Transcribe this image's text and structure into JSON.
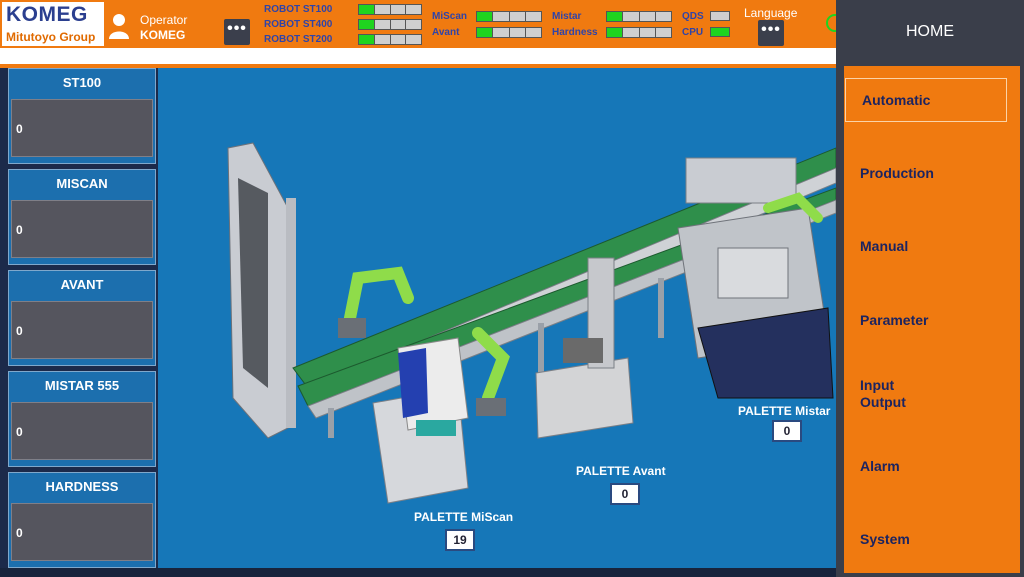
{
  "header": {
    "brand": "KOMEG",
    "group": "Mitutoyo Group",
    "operator_label": "Operator",
    "operator_name": "KOMEG",
    "more_glyph": "•••",
    "robots": [
      {
        "label": "ROBOT ST100",
        "segments": [
          true,
          false,
          false,
          false
        ]
      },
      {
        "label": "ROBOT ST400",
        "segments": [
          true,
          false,
          false,
          false
        ]
      },
      {
        "label": "ROBOT ST200",
        "segments": [
          true,
          false,
          false,
          false
        ]
      }
    ],
    "stations_status": [
      {
        "label": "MiScan",
        "segments": [
          true,
          false,
          false,
          false
        ]
      },
      {
        "label": "Avant",
        "segments": [
          true,
          false,
          false,
          false
        ]
      },
      {
        "label": "Mistar",
        "segments": [
          true,
          false,
          false,
          false
        ]
      },
      {
        "label": "Hardness",
        "segments": [
          true,
          false,
          false,
          false
        ]
      }
    ],
    "qds_label": "QDS",
    "cpu_label": "CPU",
    "language_label": "Language",
    "colors": {
      "header": "#f07a10",
      "led_on": "#1fd41f",
      "led_off": "#cfcfcf"
    }
  },
  "stations": [
    {
      "title": "ST100",
      "value": "0"
    },
    {
      "title": "MISCAN",
      "value": "0"
    },
    {
      "title": "AVANT",
      "value": "0"
    },
    {
      "title": "MISTAR 555",
      "value": "0"
    },
    {
      "title": "HARDNESS",
      "value": "0"
    }
  ],
  "scene": {
    "palettes": [
      {
        "label": "PALETTE MiScan",
        "value": "19"
      },
      {
        "label": "PALETTE Avant",
        "value": "0"
      },
      {
        "label": "PALETTE Mistar",
        "value": "0"
      }
    ]
  },
  "menu": {
    "home": "HOME",
    "items": [
      {
        "label": "Automatic",
        "active": true
      },
      {
        "label": "Production"
      },
      {
        "label": "Manual"
      },
      {
        "label": "Parameter"
      },
      {
        "label": "Input\nOutput"
      },
      {
        "label": "Alarm"
      },
      {
        "label": "System"
      }
    ]
  }
}
